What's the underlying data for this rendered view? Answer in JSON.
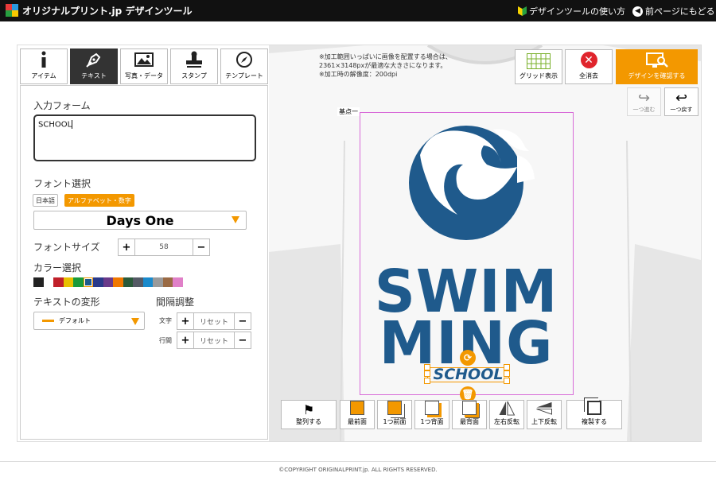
{
  "header": {
    "title": "オリジナルプリント.jp デザインツール",
    "howto_label": "デザインツールの使い方",
    "back_label": "前ページにもどる"
  },
  "tabs": [
    {
      "label": "アイテム",
      "icon": "info-icon"
    },
    {
      "label": "テキスト",
      "icon": "pen-icon",
      "active": true
    },
    {
      "label": "写真・データ",
      "icon": "image-icon"
    },
    {
      "label": "スタンプ",
      "icon": "stamp-icon"
    },
    {
      "label": "テンプレート",
      "icon": "compass-icon"
    }
  ],
  "form": {
    "input_label": "入力フォーム",
    "input_value": "SCHOOL",
    "font_label": "フォント選択",
    "font_tab_ja": "日本語",
    "font_tab_alpha": "アルファベット・数字",
    "font_name": "Days One",
    "size_label": "フォントサイズ",
    "size_value": "58",
    "color_label": "カラー選択",
    "colors": [
      "#222222",
      "#ffffff",
      "#c0202a",
      "#e8c000",
      "#1a9a3a",
      "#1f5a8c",
      "#2a3a8a",
      "#6a3a8a",
      "#f07800",
      "#2a5a3a",
      "#555a66",
      "#1a8acc",
      "#9a9a9a",
      "#9a6a44",
      "#e080c8"
    ],
    "selected_color": "#1f5a8c",
    "transform_label": "テキストの変形",
    "transform_value": "デフォルト",
    "spacing_label": "間隔調整",
    "char_label": "文字",
    "line_label": "行間",
    "reset_label": "リセット"
  },
  "canvas": {
    "note_lines": [
      "※加工範囲いっぱいに画像を配置する場合は、",
      "2361×3148pxが最適な大きさになります。",
      "※加工時の解像度：200dpi"
    ],
    "area_label": "基点一",
    "design_line1": "SWIM",
    "design_line2": "MING",
    "selected_text": "SCHOOL",
    "brand_color": "#1f5a8c",
    "accent_color": "#f39800"
  },
  "toolbar": {
    "grid_label": "グリッド表示",
    "clear_label": "全消去",
    "confirm_label": "デザインを確認する",
    "redo_label": "一つ進む",
    "undo_label": "一つ戻す"
  },
  "bottom": {
    "align": "整列する",
    "front": "最前面",
    "forward": "1つ前面",
    "backward": "1つ背面",
    "back": "最背面",
    "flip_h": "左右反転",
    "flip_v": "上下反転",
    "duplicate": "複製する"
  },
  "footer": {
    "copyright": "©COPYRIGHT ORIGINALPRINT.jp. ALL RIGHTS RESERVED."
  }
}
